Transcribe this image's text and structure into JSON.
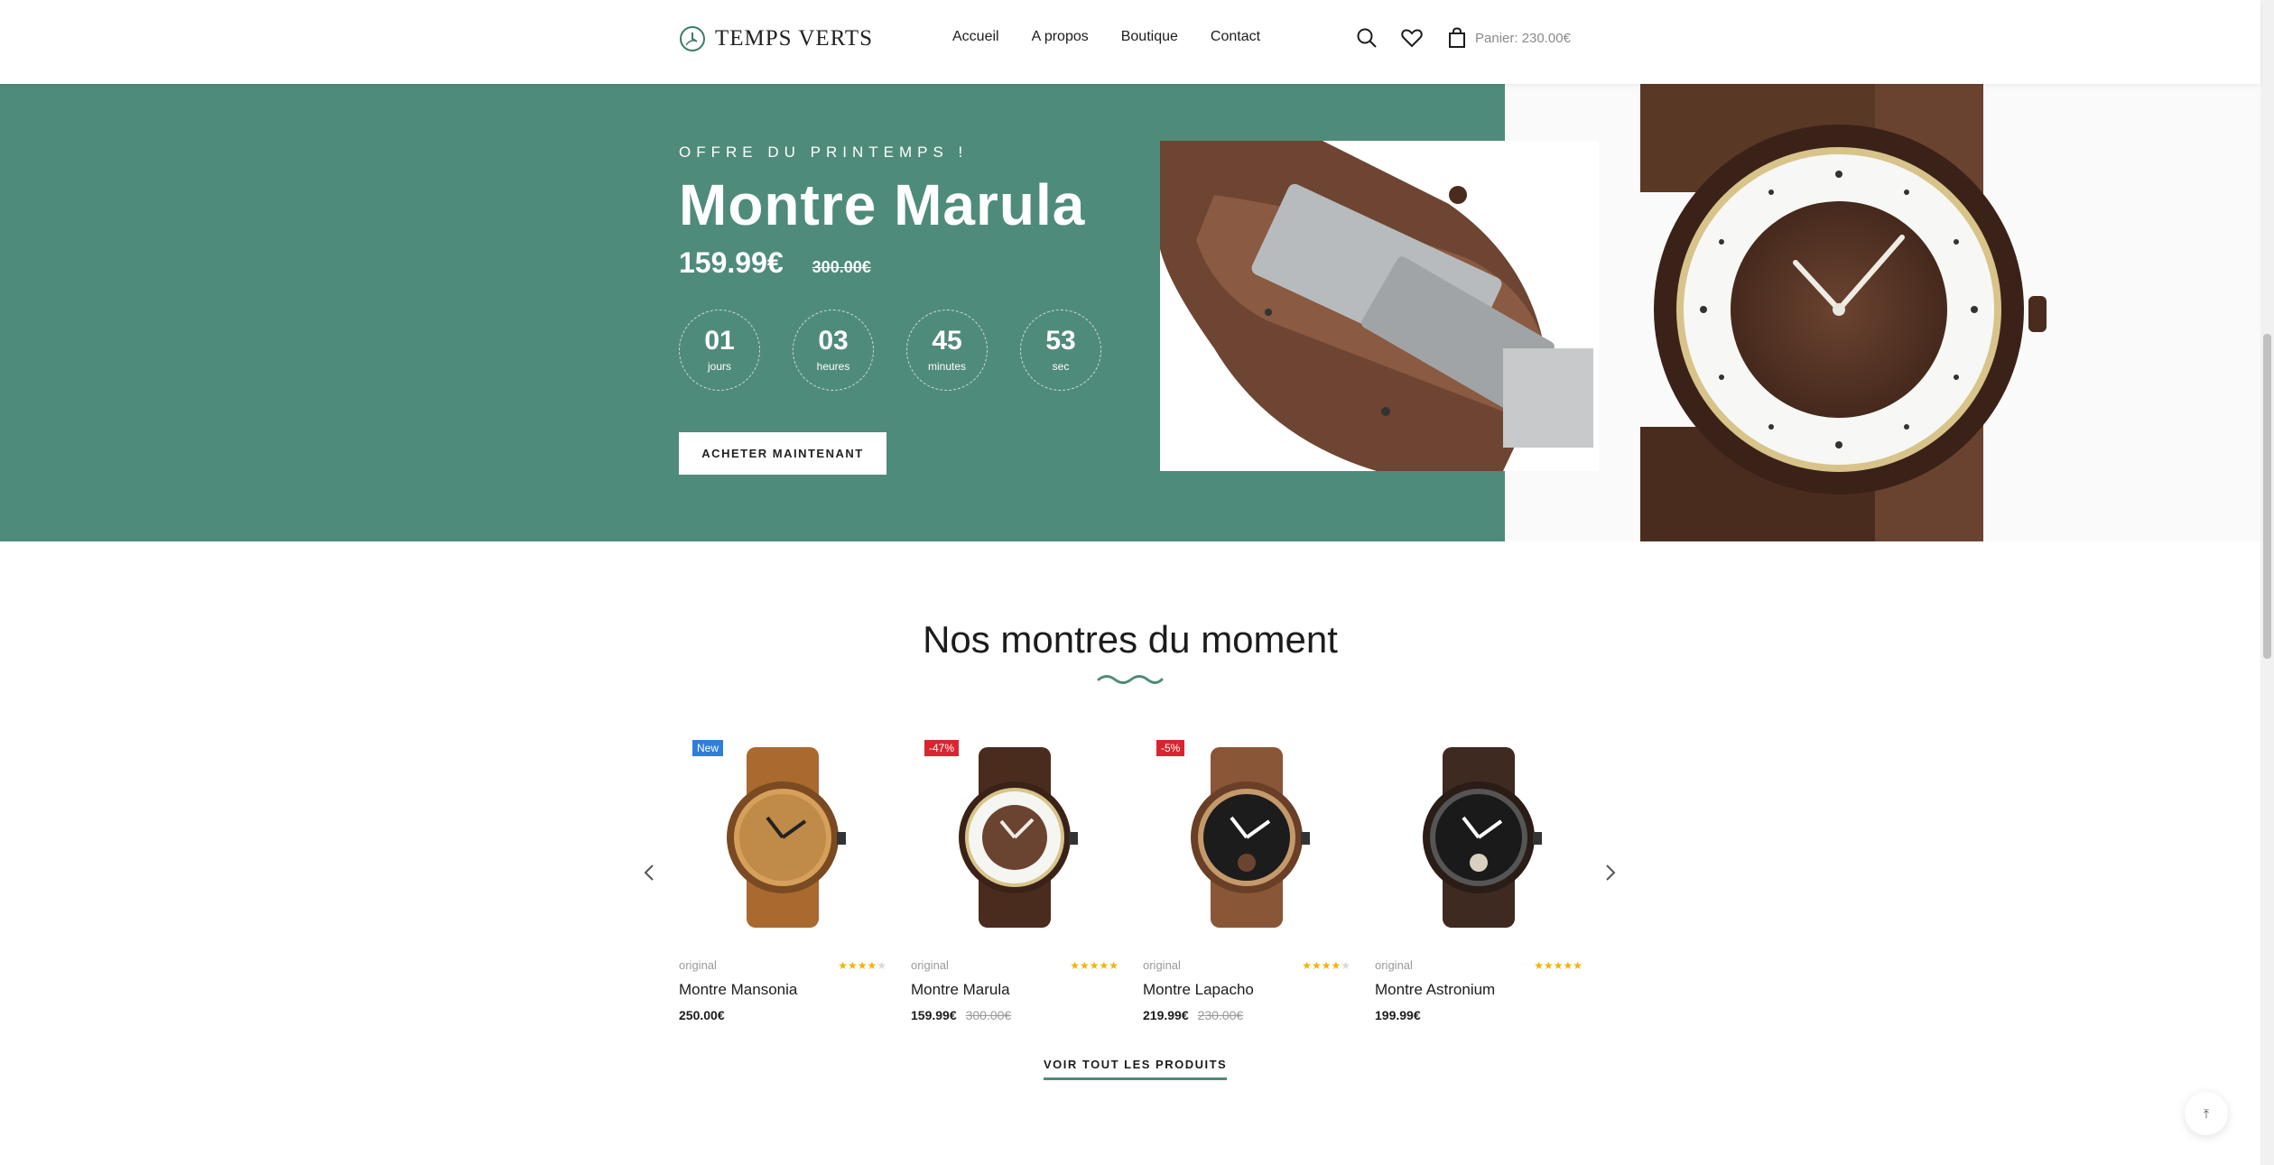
{
  "brand": {
    "name": "TEMPS VERTS"
  },
  "nav": {
    "items": [
      "Accueil",
      "A propos",
      "Boutique",
      "Contact"
    ]
  },
  "header": {
    "cart_label": "Panier: 230.00€"
  },
  "hero": {
    "eyebrow": "OFFRE DU PRINTEMPS !",
    "title": "Montre Marula",
    "price": "159.99€",
    "old_price": "300.00€",
    "countdown": [
      {
        "value": "01",
        "label": "jours"
      },
      {
        "value": "03",
        "label": "heures"
      },
      {
        "value": "45",
        "label": "minutes"
      },
      {
        "value": "53",
        "label": "sec"
      }
    ],
    "cta": "ACHETER MAINTENANT",
    "bg_color": "#4f8b7a"
  },
  "section": {
    "title": "Nos montres du moment",
    "view_all": "VOIR TOUT LES PRODUITS"
  },
  "products": [
    {
      "badge": "New",
      "badge_type": "new",
      "category": "original",
      "name": "Montre Mansonia",
      "price": "250.00€",
      "old_price": "",
      "rating": 4,
      "dial": "light"
    },
    {
      "badge": "-47%",
      "badge_type": "sale",
      "category": "original",
      "name": "Montre Marula",
      "price": "159.99€",
      "old_price": "300.00€",
      "rating": 5,
      "dial": "white"
    },
    {
      "badge": "-5%",
      "badge_type": "sale",
      "category": "original",
      "name": "Montre Lapacho",
      "price": "219.99€",
      "old_price": "230.00€",
      "rating": 4,
      "dial": "black"
    },
    {
      "badge": "",
      "badge_type": "",
      "category": "original",
      "name": "Montre Astronium",
      "price": "199.99€",
      "old_price": "",
      "rating": 5,
      "dial": "black"
    }
  ]
}
